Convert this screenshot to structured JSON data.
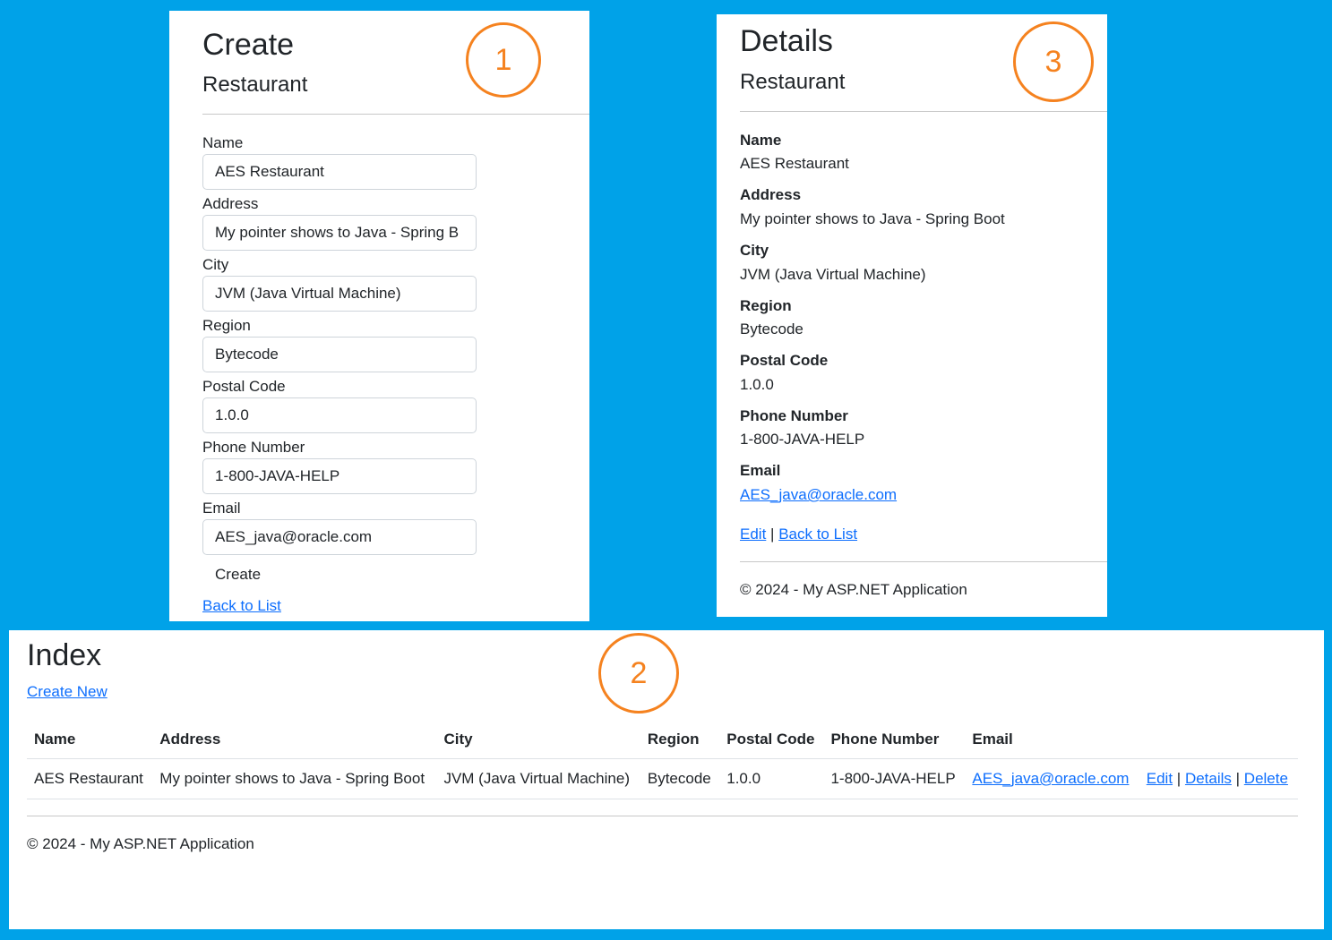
{
  "create": {
    "title": "Create",
    "subtitle": "Restaurant",
    "fields": [
      {
        "label": "Name",
        "value": "AES Restaurant"
      },
      {
        "label": "Address",
        "value": "My pointer shows to Java - Spring B"
      },
      {
        "label": "City",
        "value": "JVM (Java Virtual Machine)"
      },
      {
        "label": "Region",
        "value": "Bytecode"
      },
      {
        "label": "Postal Code",
        "value": "1.0.0"
      },
      {
        "label": "Phone Number",
        "value": "1-800-JAVA-HELP"
      },
      {
        "label": "Email",
        "value": "AES_java@oracle.com"
      }
    ],
    "submit_label": "Create",
    "back_link": "Back to List",
    "marker": "1"
  },
  "details": {
    "title": "Details",
    "subtitle": "Restaurant",
    "fields": [
      {
        "label": "Name",
        "value": "AES Restaurant"
      },
      {
        "label": "Address",
        "value": "My pointer shows to Java - Spring Boot"
      },
      {
        "label": "City",
        "value": "JVM (Java Virtual Machine)"
      },
      {
        "label": "Region",
        "value": "Bytecode"
      },
      {
        "label": "Postal Code",
        "value": "1.0.0"
      },
      {
        "label": "Phone Number",
        "value": "1-800-JAVA-HELP"
      },
      {
        "label": "Email",
        "value": "AES_java@oracle.com"
      }
    ],
    "edit_link": "Edit",
    "separator": "|",
    "back_link": "Back to List",
    "footer": "© 2024 - My ASP.NET Application",
    "marker": "3"
  },
  "index": {
    "title": "Index",
    "create_new": "Create New",
    "columns": [
      "Name",
      "Address",
      "City",
      "Region",
      "Postal Code",
      "Phone Number",
      "Email"
    ],
    "rows": [
      {
        "cells": [
          "AES Restaurant",
          "My pointer shows to Java - Spring Boot",
          "JVM (Java Virtual Machine)",
          "Bytecode",
          "1.0.0",
          "1-800-JAVA-HELP"
        ],
        "email": "AES_java@oracle.com",
        "actions": {
          "edit": "Edit",
          "details": "Details",
          "delete": "Delete",
          "separator": "|"
        }
      }
    ],
    "footer": "© 2024 - My ASP.NET Application",
    "marker": "2"
  },
  "colors": {
    "background": "#00a2e8",
    "marker": "#f5821f",
    "link": "#0d6efd"
  }
}
